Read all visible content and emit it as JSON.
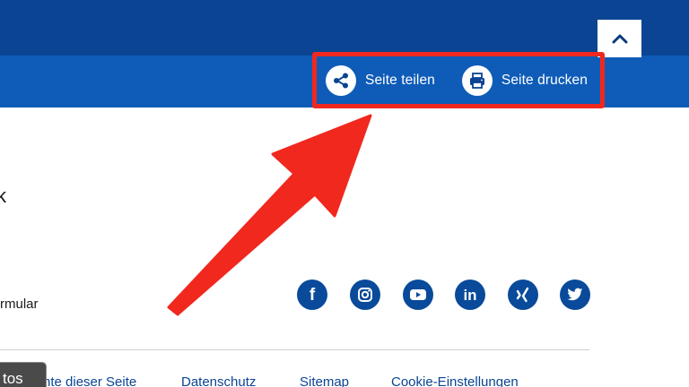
{
  "header": {
    "scroll_top_icon": "chevron-up-icon",
    "share_label": "Seite teilen",
    "print_label": "Seite drucken",
    "share_icon": "share-icon",
    "print_icon": "printer-icon",
    "highlight_color": "#f0281e",
    "top_band_color": "#0a4493",
    "sub_band_color": "#0e5cb8"
  },
  "content": {
    "stray_glyph": "k",
    "form_link_text": "rmular"
  },
  "social": {
    "color": "#0a4a9a",
    "items": [
      {
        "icon": "facebook-icon"
      },
      {
        "icon": "instagram-icon"
      },
      {
        "icon": "youtube-icon"
      },
      {
        "icon": "linkedin-icon"
      },
      {
        "icon": "xing-icon"
      },
      {
        "icon": "twitter-icon"
      }
    ]
  },
  "footer": {
    "links": [
      "nte dieser Seite",
      "Datenschutz",
      "Sitemap",
      "Cookie-Einstellungen"
    ]
  },
  "tooltip": {
    "text": "tos"
  },
  "annotation": {
    "arrow_color": "#f0281e"
  }
}
